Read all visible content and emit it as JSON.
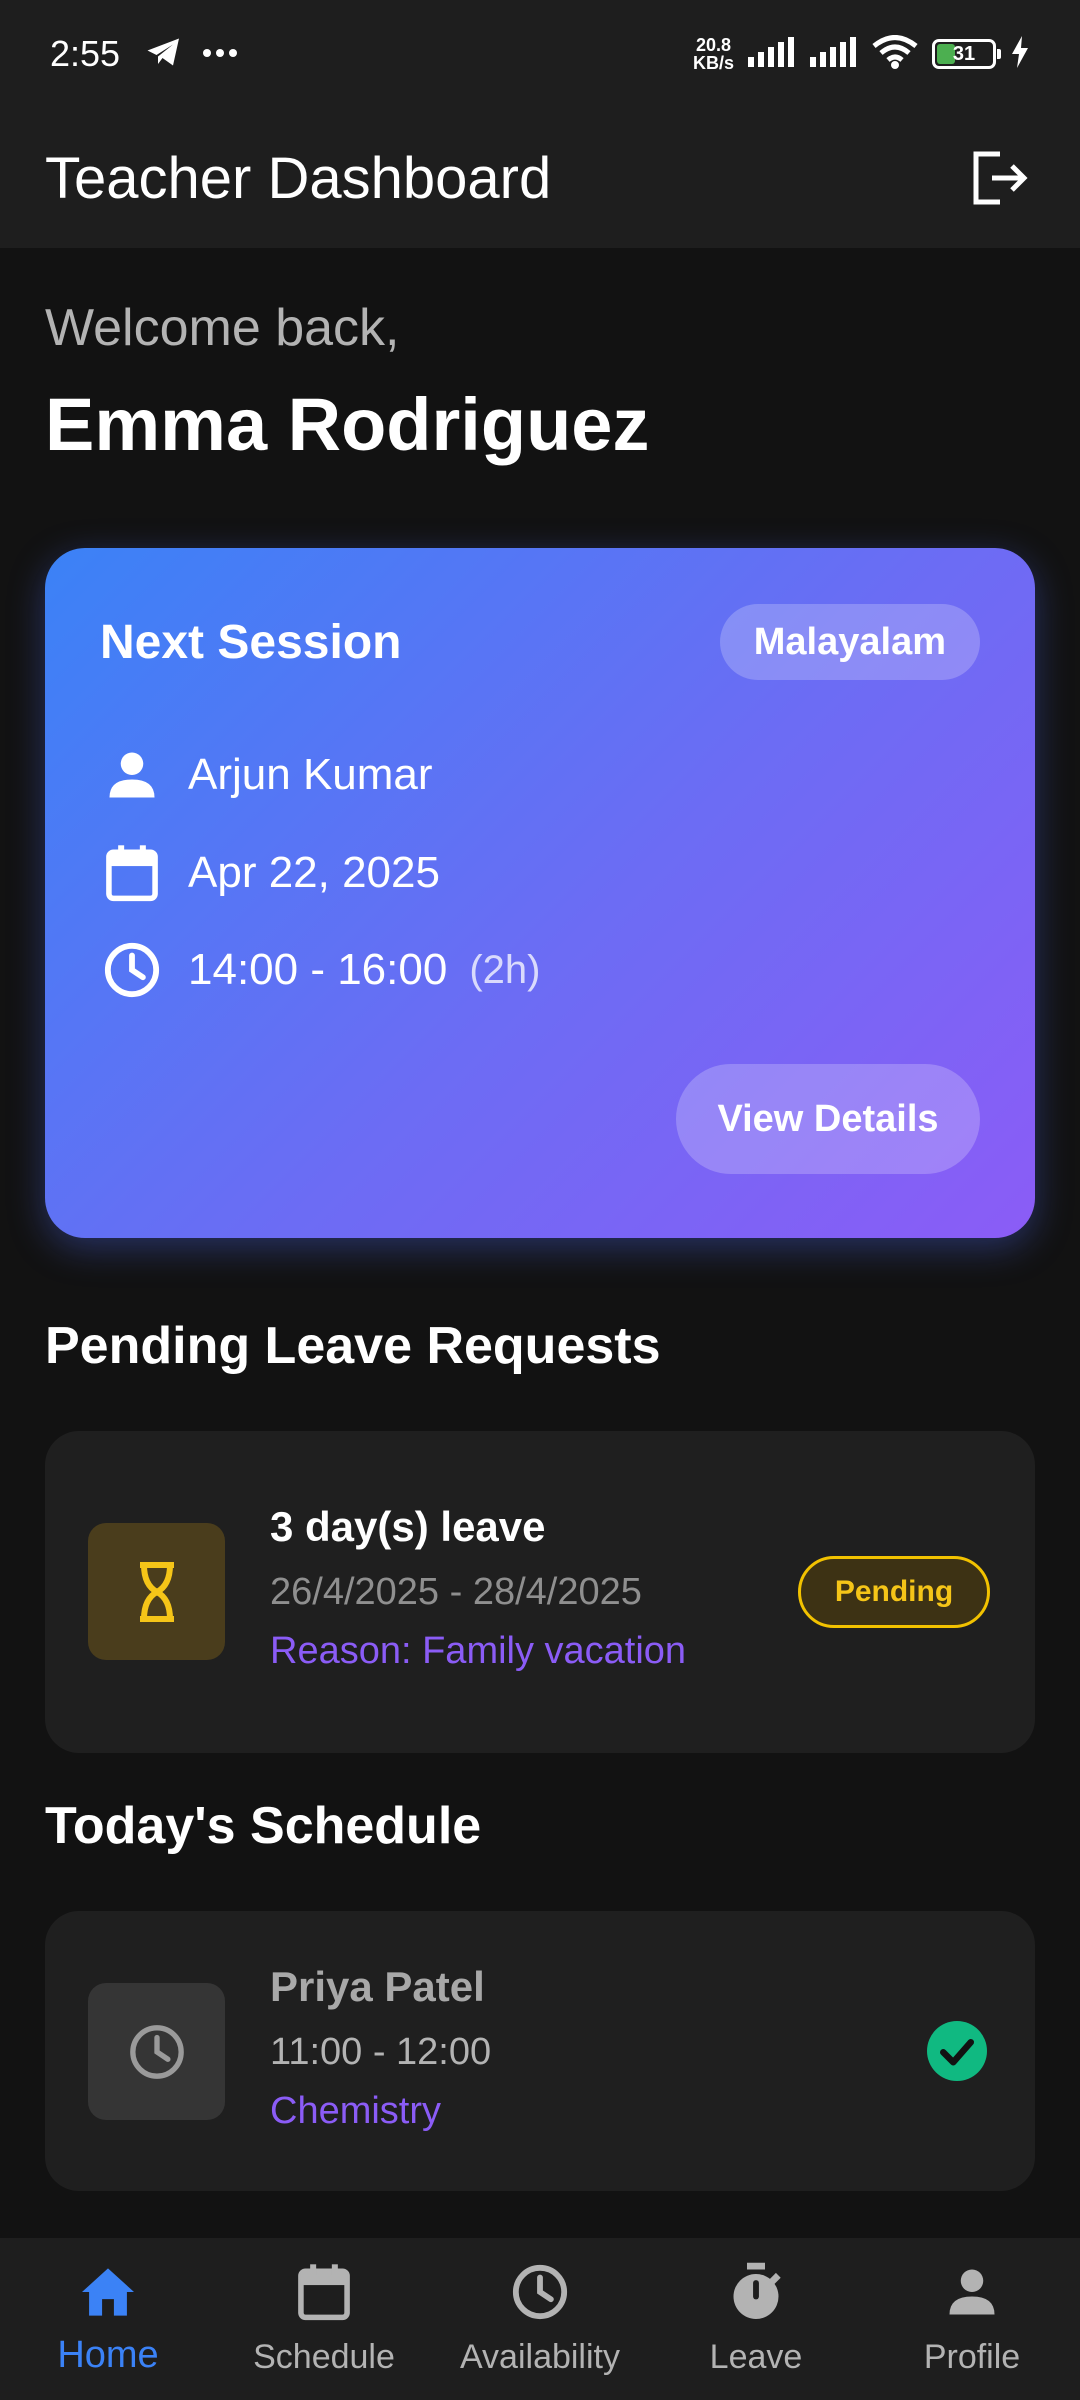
{
  "status_bar": {
    "time": "2:55",
    "net_speed_value": "20.8",
    "net_speed_unit": "KB/s",
    "battery": "31",
    "battery_level": 0.31
  },
  "app_bar": {
    "title": "Teacher Dashboard",
    "logout_icon": "logout-icon"
  },
  "welcome": {
    "greeting": "Welcome back,",
    "name": "Emma Rodriguez"
  },
  "next_session": {
    "title": "Next Session",
    "language": "Malayalam",
    "student": "Arjun Kumar",
    "date": "Apr 22, 2025",
    "time": "14:00 - 16:00",
    "duration": "(2h)",
    "button": "View Details",
    "gradient": [
      "#3b82f6",
      "#8b5cf6"
    ]
  },
  "pending_leave": {
    "title": "Pending Leave Requests",
    "items": [
      {
        "title": "3 day(s) leave",
        "dates": "26/4/2025 - 28/4/2025",
        "reason": "Reason: Family vacation",
        "status": "Pending",
        "icon": "hourglass-icon"
      }
    ]
  },
  "todays_schedule": {
    "title": "Today's Schedule",
    "items": [
      {
        "student": "Priya Patel",
        "time": "11:00 - 12:00",
        "subject": "Chemistry",
        "icon": "clock-icon",
        "status_icon": "check-circle-icon"
      }
    ]
  },
  "bottom_nav": {
    "items": [
      {
        "label": "Home",
        "icon": "home-icon",
        "active": true
      },
      {
        "label": "Schedule",
        "icon": "calendar-icon",
        "active": false
      },
      {
        "label": "Availability",
        "icon": "clock-icon",
        "active": false
      },
      {
        "label": "Leave",
        "icon": "timer-icon",
        "active": false
      },
      {
        "label": "Profile",
        "icon": "person-icon",
        "active": false
      }
    ]
  },
  "colors": {
    "background": "#121212",
    "surface": "#1f1f1f",
    "accent_blue": "#3b82f6",
    "accent_purple": "#8b5cf6",
    "pending_yellow": "#f5c518",
    "success_green": "#10b981"
  }
}
